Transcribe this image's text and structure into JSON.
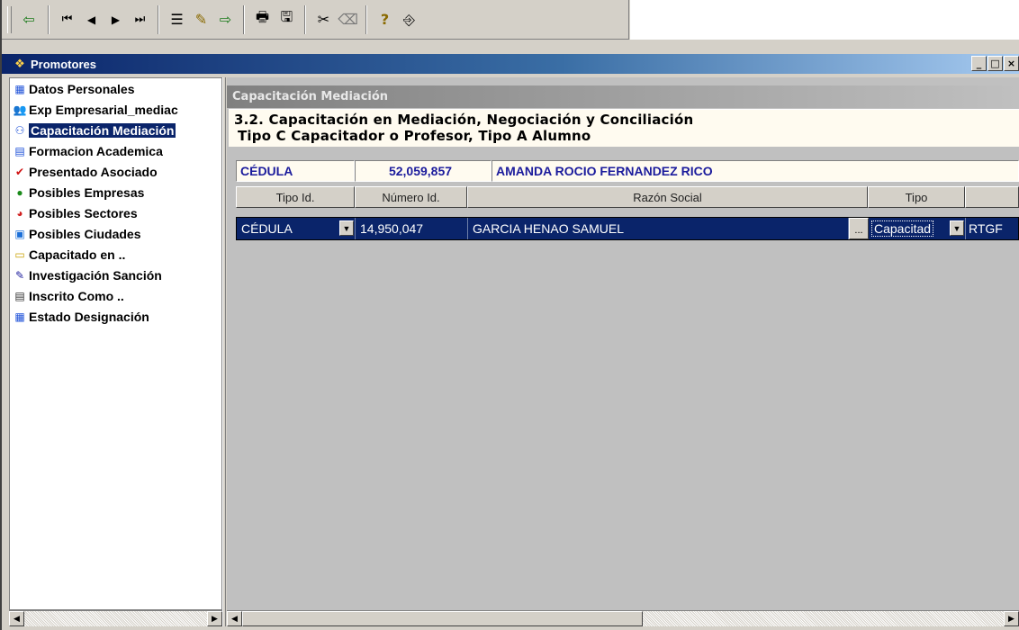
{
  "toolbar": {
    "buttons": [
      {
        "name": "exit-icon",
        "glyph": "⇦"
      },
      {
        "name": "first-record-icon",
        "glyph": "⏮"
      },
      {
        "name": "previous-record-icon",
        "glyph": "◀"
      },
      {
        "name": "next-record-icon",
        "glyph": "▶"
      },
      {
        "name": "last-record-icon",
        "glyph": "⏭"
      },
      {
        "name": "insert-icon",
        "glyph": "☰"
      },
      {
        "name": "edit-icon",
        "glyph": "✎"
      },
      {
        "name": "go-icon",
        "glyph": "⇨"
      },
      {
        "name": "print-icon",
        "glyph": "🖶"
      },
      {
        "name": "save-icon",
        "glyph": "🖫"
      },
      {
        "name": "cut-icon",
        "glyph": "✂"
      },
      {
        "name": "eraser-icon",
        "glyph": "⌫"
      },
      {
        "name": "help-icon",
        "glyph": "?"
      },
      {
        "name": "exit-door-icon",
        "glyph": "⎆"
      }
    ]
  },
  "window": {
    "title": "Promotores",
    "min_label": "_",
    "max_label": "□",
    "close_label": "×"
  },
  "tree": {
    "items": [
      {
        "label": "Datos Personales",
        "icon": "grid-icon",
        "glyph": "▦",
        "color": "#1b4fd8",
        "selected": false
      },
      {
        "label": "Exp Empresarial_mediac",
        "icon": "people-icon",
        "glyph": "👥",
        "color": "#7a5a00",
        "selected": false
      },
      {
        "label": "Capacitación Mediación",
        "icon": "training-icon",
        "glyph": "⚇",
        "color": "#1b4fd8",
        "selected": true
      },
      {
        "label": "Formacion Academica",
        "icon": "book-icon",
        "glyph": "▤",
        "color": "#1b4fd8",
        "selected": false
      },
      {
        "label": "Presentado Asociado",
        "icon": "checkmark-icon",
        "glyph": "✔",
        "color": "#d01010",
        "selected": false
      },
      {
        "label": "Posibles Empresas",
        "icon": "money-bag-icon",
        "glyph": "●",
        "color": "#1a8a1a",
        "selected": false
      },
      {
        "label": "Posibles Sectores",
        "icon": "pie-chart-icon",
        "glyph": "◕",
        "color": "#d02020",
        "selected": false
      },
      {
        "label": "Posibles Ciudades",
        "icon": "city-icon",
        "glyph": "▣",
        "color": "#1b6fd8",
        "selected": false
      },
      {
        "label": "Capacitado en ..",
        "icon": "folder-icon",
        "glyph": "▭",
        "color": "#c8a000",
        "selected": false
      },
      {
        "label": "Investigación Sanción",
        "icon": "note-edit-icon",
        "glyph": "✎",
        "color": "#1b1b9c",
        "selected": false
      },
      {
        "label": "Inscrito Como ..",
        "icon": "id-card-icon",
        "glyph": "▤",
        "color": "#303030",
        "selected": false
      },
      {
        "label": "Estado Designación",
        "icon": "table-icon",
        "glyph": "▦",
        "color": "#1b4fd8",
        "selected": false
      }
    ]
  },
  "panel": {
    "caption": "Capacitación Mediación",
    "heading_line1": "3.2.  Capacitación en Mediación, Negociación y Conciliación",
    "heading_line2": "Tipo C Capacitador o Profesor, Tipo A  Alumno",
    "person": {
      "id_type": "CÉDULA",
      "id_number": "52,059,857",
      "name": "AMANDA ROCIO FERNANDEZ RICO"
    },
    "grid": {
      "headers": [
        "Tipo Id.",
        "Número Id.",
        "Razón Social",
        "Tipo",
        ""
      ],
      "rows": [
        {
          "tipo_id": "CÉDULA",
          "numero_id": "14,950,047",
          "razon_social": "GARCIA HENAO SAMUEL",
          "ellipsis": "...",
          "tipo": "Capacitad",
          "extra": "RTGF"
        }
      ]
    }
  }
}
